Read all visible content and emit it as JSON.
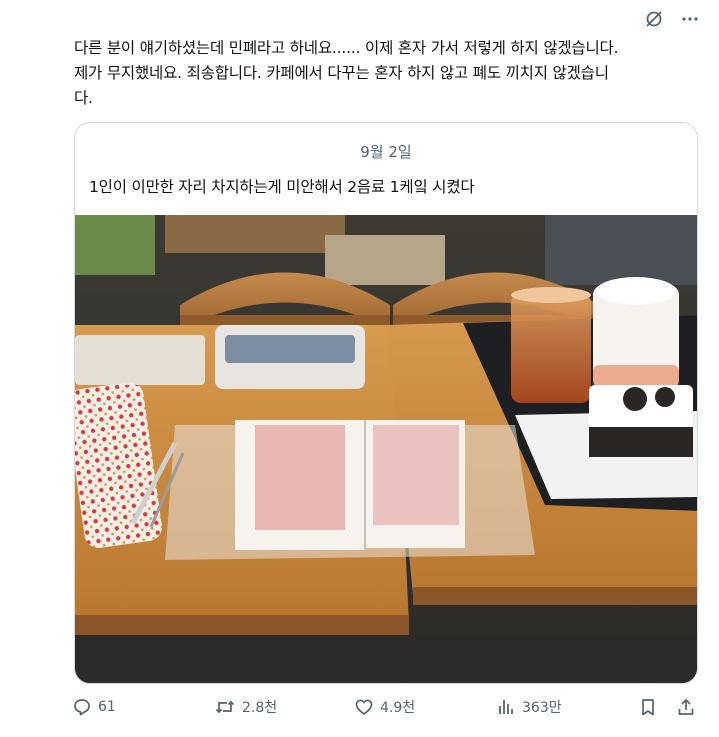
{
  "post": {
    "text_lines": [
      "다른 분이 얘기하셨는데 민폐라고 하네요...... 이제 혼자 가서 저렇게 하지 않겠습니다.",
      "제가 무지했네요. 죄송합니다. 카페에서 다꾸는 혼자 하지 않고 폐도 끼치지 않겠습니",
      "다."
    ]
  },
  "quote": {
    "date": "9월 2일",
    "text": "1인이 이만한 자리 차지하는게 미안해서 2음료 1케잌 시켰다"
  },
  "actions": {
    "replies": "61",
    "reposts": "2.8천",
    "likes": "4.9천",
    "views": "363만"
  },
  "icons": {
    "top": [
      "grok-icon",
      "more-icon"
    ],
    "bottom": [
      "reply-icon",
      "repost-icon",
      "like-icon",
      "views-icon",
      "bookmark-icon",
      "share-icon"
    ]
  },
  "colors": {
    "text": "#0f1419",
    "muted": "#536471",
    "border": "#cfd9de"
  }
}
